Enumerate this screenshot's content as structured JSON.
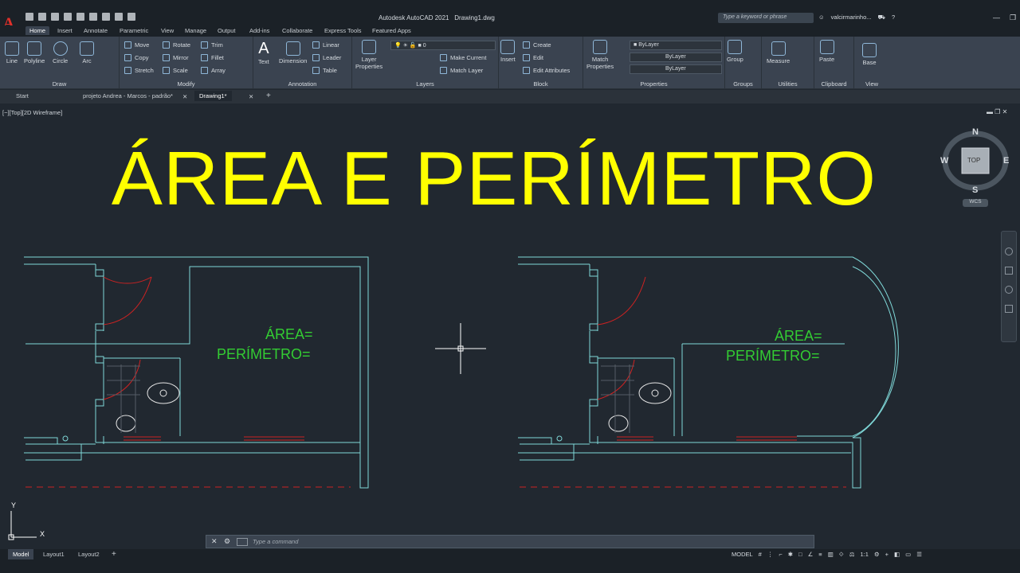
{
  "app": {
    "title": "Autodesk AutoCAD 2021",
    "document": "Drawing1.dwg",
    "logo": "A",
    "search_placeholder": "Type a keyword or phrase",
    "user": "valcirmarinho..."
  },
  "ribbon_tabs": [
    "Home",
    "Insert",
    "Annotate",
    "Parametric",
    "View",
    "Manage",
    "Output",
    "Add-ins",
    "Collaborate",
    "Express Tools",
    "Featured Apps"
  ],
  "panels": {
    "draw": {
      "label": "Draw",
      "tools": [
        "Line",
        "Polyline",
        "Circle",
        "Arc"
      ]
    },
    "modify": {
      "label": "Modify",
      "rows": [
        [
          "Move",
          "Rotate",
          "Trim"
        ],
        [
          "Copy",
          "Mirror",
          "Fillet"
        ],
        [
          "Stretch",
          "Scale",
          "Array"
        ]
      ]
    },
    "annotation": {
      "label": "Annotation",
      "text": "Text",
      "dimension": "Dimension",
      "linear": "Linear",
      "leader": "Leader",
      "table": "Table"
    },
    "layers": {
      "label": "Layers",
      "layer_props": "Layer\nProperties",
      "current_layer": "0",
      "make_current": "Make Current",
      "match_layer": "Match Layer"
    },
    "block": {
      "label": "Block",
      "insert": "Insert",
      "create": "Create",
      "edit": "Edit",
      "edit_attributes": "Edit Attributes"
    },
    "properties": {
      "label": "Properties",
      "match": "Match\nProperties",
      "color": "ByLayer",
      "linetype": "ByLayer",
      "lineweight": "ByLayer"
    },
    "groups": {
      "label": "Groups",
      "group": "Group"
    },
    "utilities": {
      "label": "Utilities",
      "measure": "Measure"
    },
    "clipboard": {
      "label": "Clipboard",
      "paste": "Paste"
    },
    "view": {
      "label": "View",
      "base": "Base"
    }
  },
  "doc_tabs": [
    "Start",
    "projeto Andrea - Marcos - padrão*",
    "Drawing1*"
  ],
  "viewport": {
    "label": "[−][Top][2D Wireframe]",
    "title": "ÁREA E PERÍMETRO",
    "left_area_label": "ÁREA=",
    "left_perimeter_label": "PERÍMETRO=",
    "right_area_label": "ÁREA=",
    "right_perimeter_label": "PERÍMETRO=",
    "viewcube": {
      "n": "N",
      "s": "S",
      "e": "E",
      "w": "W",
      "top": "TOP",
      "wcs": "WCS"
    },
    "ucs_y": "Y",
    "ucs_x": "X"
  },
  "command": {
    "placeholder": "Type a command"
  },
  "layout_tabs": [
    "Model",
    "Layout1",
    "Layout2"
  ],
  "status": {
    "model": "MODEL",
    "scale": "1:1"
  },
  "colors": {
    "title_yellow": "#ffff00",
    "wall_cyan": "#7fd8d8",
    "text_green": "#33cc33",
    "door_red": "#cc2222",
    "bg": "#212830"
  }
}
